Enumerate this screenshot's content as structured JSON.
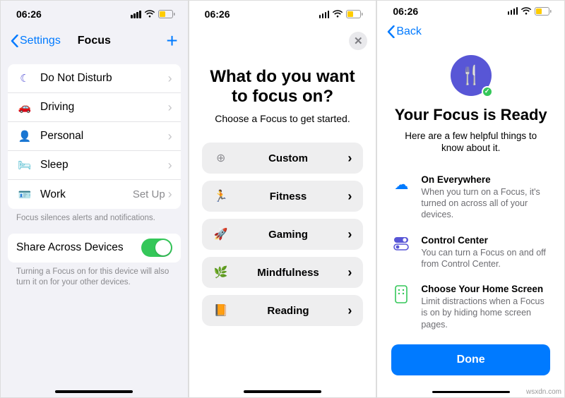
{
  "status": {
    "time": "06:26"
  },
  "screen1": {
    "back_label": "Settings",
    "title": "Focus",
    "items": [
      {
        "label": "Do Not Disturb",
        "detail": ""
      },
      {
        "label": "Driving",
        "detail": ""
      },
      {
        "label": "Personal",
        "detail": ""
      },
      {
        "label": "Sleep",
        "detail": ""
      },
      {
        "label": "Work",
        "detail": "Set Up"
      }
    ],
    "footer1": "Focus silences alerts and notifications.",
    "share_label": "Share Across Devices",
    "footer2": "Turning a Focus on for this device will also turn it on for your other devices."
  },
  "screen2": {
    "title": "What do you want to focus on?",
    "subtitle": "Choose a Focus to get started.",
    "options": [
      {
        "label": "Custom",
        "icon": "plus-circle"
      },
      {
        "label": "Fitness",
        "icon": "running",
        "color": "#34c759"
      },
      {
        "label": "Gaming",
        "icon": "rocket",
        "color": "#0a84ff"
      },
      {
        "label": "Mindfulness",
        "icon": "leaf",
        "color": "#30b0c7"
      },
      {
        "label": "Reading",
        "icon": "book",
        "color": "#ff9500"
      }
    ]
  },
  "screen3": {
    "back_label": "Back",
    "title": "Your Focus is Ready",
    "subtitle": "Here are a few helpful things to know about it.",
    "rows": [
      {
        "title": "On Everywhere",
        "body": "When you turn on a Focus, it's turned on across all of your devices."
      },
      {
        "title": "Control Center",
        "body": "You can turn a Focus on and off from Control Center."
      },
      {
        "title": "Choose Your Home Screen",
        "body": "Limit distractions when a Focus is on by hiding home screen pages."
      }
    ],
    "done_label": "Done"
  },
  "watermark": "wsxdn.com"
}
